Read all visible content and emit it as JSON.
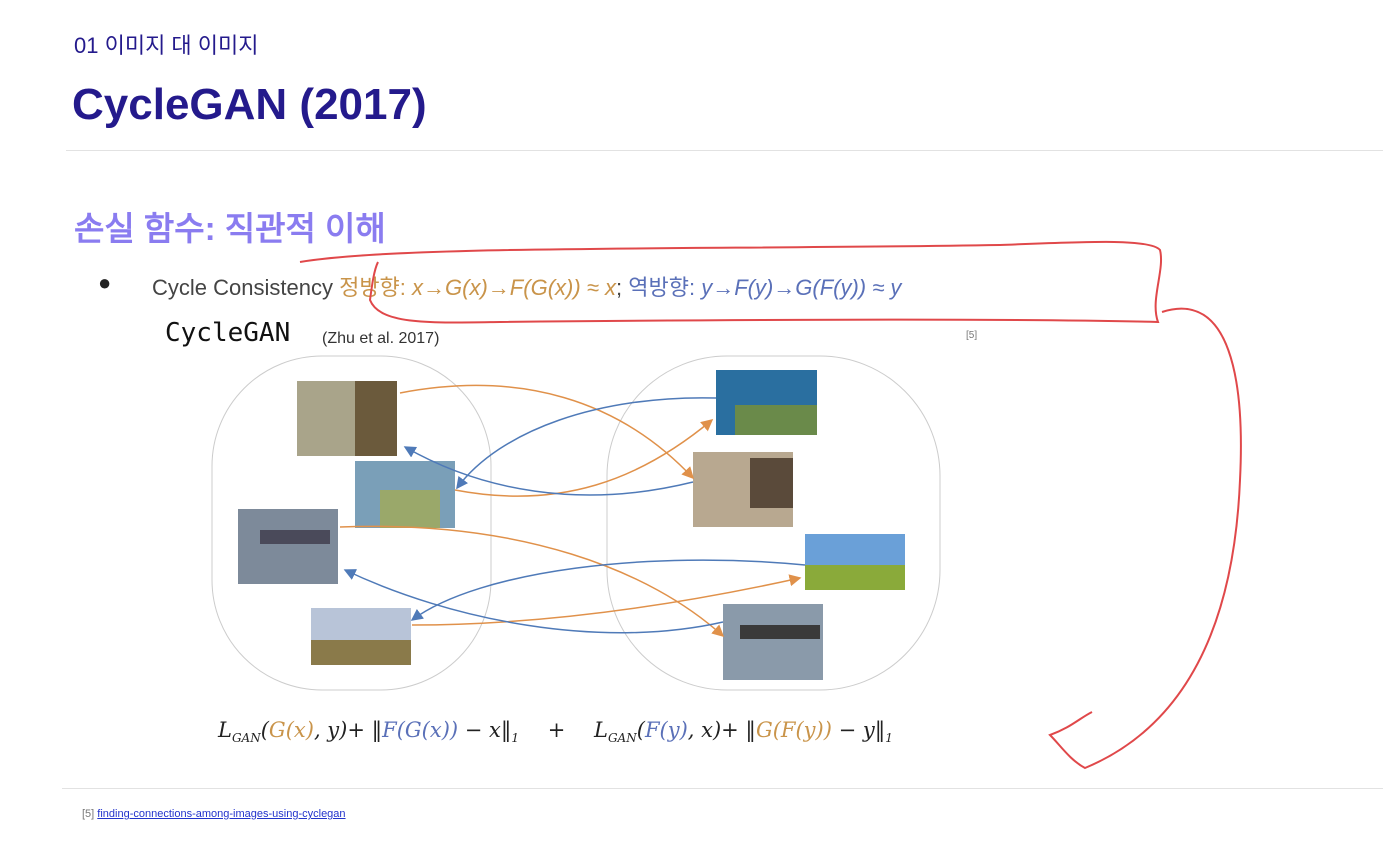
{
  "section": "01 이미지 대 이미지",
  "title": "CycleGAN (2017)",
  "subtitle": "손실 함수: 직관적 이해",
  "bullet": {
    "label": "Cycle Consistency",
    "forward_label": "정방향:",
    "forward_expr": "x→G(x)→F(G(x)) ≈ x",
    "sep": ";",
    "backward_label": "역방향:",
    "backward_expr": "y→F(y)→G(F(y)) ≈ y"
  },
  "figure": {
    "title": "CycleGAN",
    "citation": "(Zhu et al. 2017)",
    "ref": "[5]"
  },
  "formula": {
    "l1": "L",
    "s1": "GAN",
    "p1": "(",
    "g1": "G(x)",
    "p2": ", y)+ ‖",
    "f1": "F(G(x))",
    "p3": " − x‖",
    "n1": "1",
    "plus": "+",
    "l2": "L",
    "s2": "GAN",
    "p4": "(",
    "f2": "F(y)",
    "p5": ", x)+ ‖",
    "g2": "G(F(y))",
    "p6": " − y‖",
    "n2": "1"
  },
  "footer": {
    "ref": "[5]",
    "link": "finding-connections-among-images-using-cyclegan"
  },
  "colors": {
    "orange": "#e0914a",
    "blue": "#4f7ab8",
    "annotation": "#e0484a"
  }
}
